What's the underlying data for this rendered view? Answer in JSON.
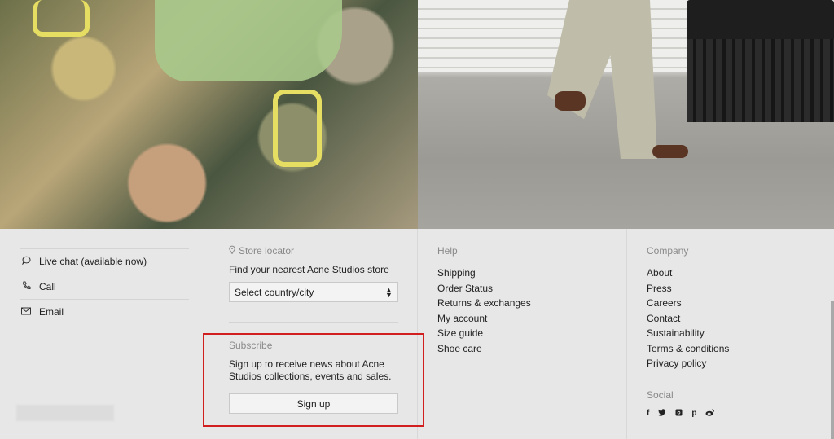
{
  "contact": {
    "items": [
      {
        "icon": "chat-bubble-icon",
        "label": "Live chat (available now)"
      },
      {
        "icon": "phone-icon",
        "label": "Call"
      },
      {
        "icon": "envelope-icon",
        "label": "Email"
      }
    ]
  },
  "store_locator": {
    "title": "Store locator",
    "subtitle": "Find your nearest Acne Studios store",
    "select_value": "Select country/city"
  },
  "subscribe": {
    "title": "Subscribe",
    "text": "Sign up to receive news about Acne Studios collections, events and sales.",
    "button": "Sign up"
  },
  "help": {
    "title": "Help",
    "links": [
      "Shipping",
      "Order Status",
      "Returns & exchanges",
      "My account",
      "Size guide",
      "Shoe care"
    ]
  },
  "company": {
    "title": "Company",
    "links": [
      "About",
      "Press",
      "Careers",
      "Contact",
      "Sustainability",
      "Terms & conditions",
      "Privacy policy"
    ],
    "social_title": "Social",
    "social": [
      {
        "name": "facebook-icon",
        "glyph": "f"
      },
      {
        "name": "twitter-icon",
        "glyph": "t"
      },
      {
        "name": "instagram-icon",
        "glyph": "◙"
      },
      {
        "name": "pinterest-icon",
        "glyph": "p"
      },
      {
        "name": "weibo-icon",
        "glyph": "w"
      }
    ]
  },
  "colors": {
    "highlight": "#d11f1f",
    "background": "#e7e7e7"
  }
}
